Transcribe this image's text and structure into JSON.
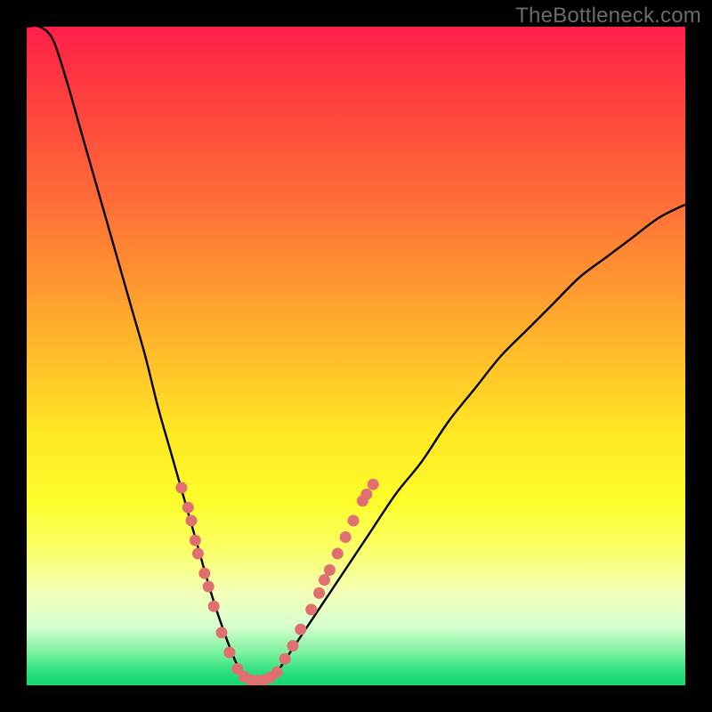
{
  "watermark": "TheBottleneck.com",
  "colors": {
    "curve_stroke": "#000000",
    "dot_fill": "#e0706f",
    "frame_bg": "#000000"
  },
  "chart_data": {
    "type": "line",
    "title": "",
    "xlabel": "",
    "ylabel": "",
    "xlim": [
      0,
      100
    ],
    "ylim": [
      0,
      100
    ],
    "notes": "Unlabeled bottleneck-style curve. y ≈ 100 is top (red / high bottleneck), y ≈ 0 is bottom (green / balanced). Minimum near x ≈ 34 at y ≈ 0. Dots are sample markers along the curve in the low-y region.",
    "x": [
      0,
      2,
      4,
      6,
      8,
      10,
      12,
      14,
      16,
      18,
      20,
      22,
      24,
      26,
      28,
      30,
      32,
      34,
      36,
      38,
      40,
      44,
      48,
      52,
      56,
      60,
      64,
      68,
      72,
      76,
      80,
      84,
      88,
      92,
      96,
      100
    ],
    "y": [
      100,
      100,
      98,
      92,
      85,
      78,
      71,
      64,
      57,
      50,
      42,
      35,
      28,
      21,
      14,
      8,
      3,
      0,
      0,
      2,
      5,
      11,
      17,
      23,
      29,
      34,
      40,
      45,
      50,
      54,
      58,
      62,
      65,
      68,
      71,
      73
    ],
    "dots": [
      {
        "x": 23.5,
        "y": 30
      },
      {
        "x": 24.5,
        "y": 27
      },
      {
        "x": 25.0,
        "y": 25
      },
      {
        "x": 25.6,
        "y": 22
      },
      {
        "x": 26.0,
        "y": 20
      },
      {
        "x": 27.0,
        "y": 17
      },
      {
        "x": 27.6,
        "y": 15
      },
      {
        "x": 28.4,
        "y": 12
      },
      {
        "x": 29.6,
        "y": 8
      },
      {
        "x": 30.8,
        "y": 5
      },
      {
        "x": 32.0,
        "y": 2.5
      },
      {
        "x": 33.0,
        "y": 1.3
      },
      {
        "x": 34.0,
        "y": 0.8
      },
      {
        "x": 35.0,
        "y": 0.7
      },
      {
        "x": 36.0,
        "y": 0.8
      },
      {
        "x": 37.0,
        "y": 1.2
      },
      {
        "x": 38.0,
        "y": 2.0
      },
      {
        "x": 39.2,
        "y": 4.0
      },
      {
        "x": 40.4,
        "y": 6.0
      },
      {
        "x": 41.6,
        "y": 8.5
      },
      {
        "x": 43.2,
        "y": 11.5
      },
      {
        "x": 44.4,
        "y": 14.0
      },
      {
        "x": 45.2,
        "y": 16.0
      },
      {
        "x": 46.0,
        "y": 17.5
      },
      {
        "x": 47.2,
        "y": 20.0
      },
      {
        "x": 48.4,
        "y": 22.5
      },
      {
        "x": 49.6,
        "y": 25.0
      },
      {
        "x": 51.0,
        "y": 28.0
      },
      {
        "x": 51.6,
        "y": 29.0
      },
      {
        "x": 52.6,
        "y": 30.5
      }
    ],
    "dot_radius_px": 6.5
  }
}
